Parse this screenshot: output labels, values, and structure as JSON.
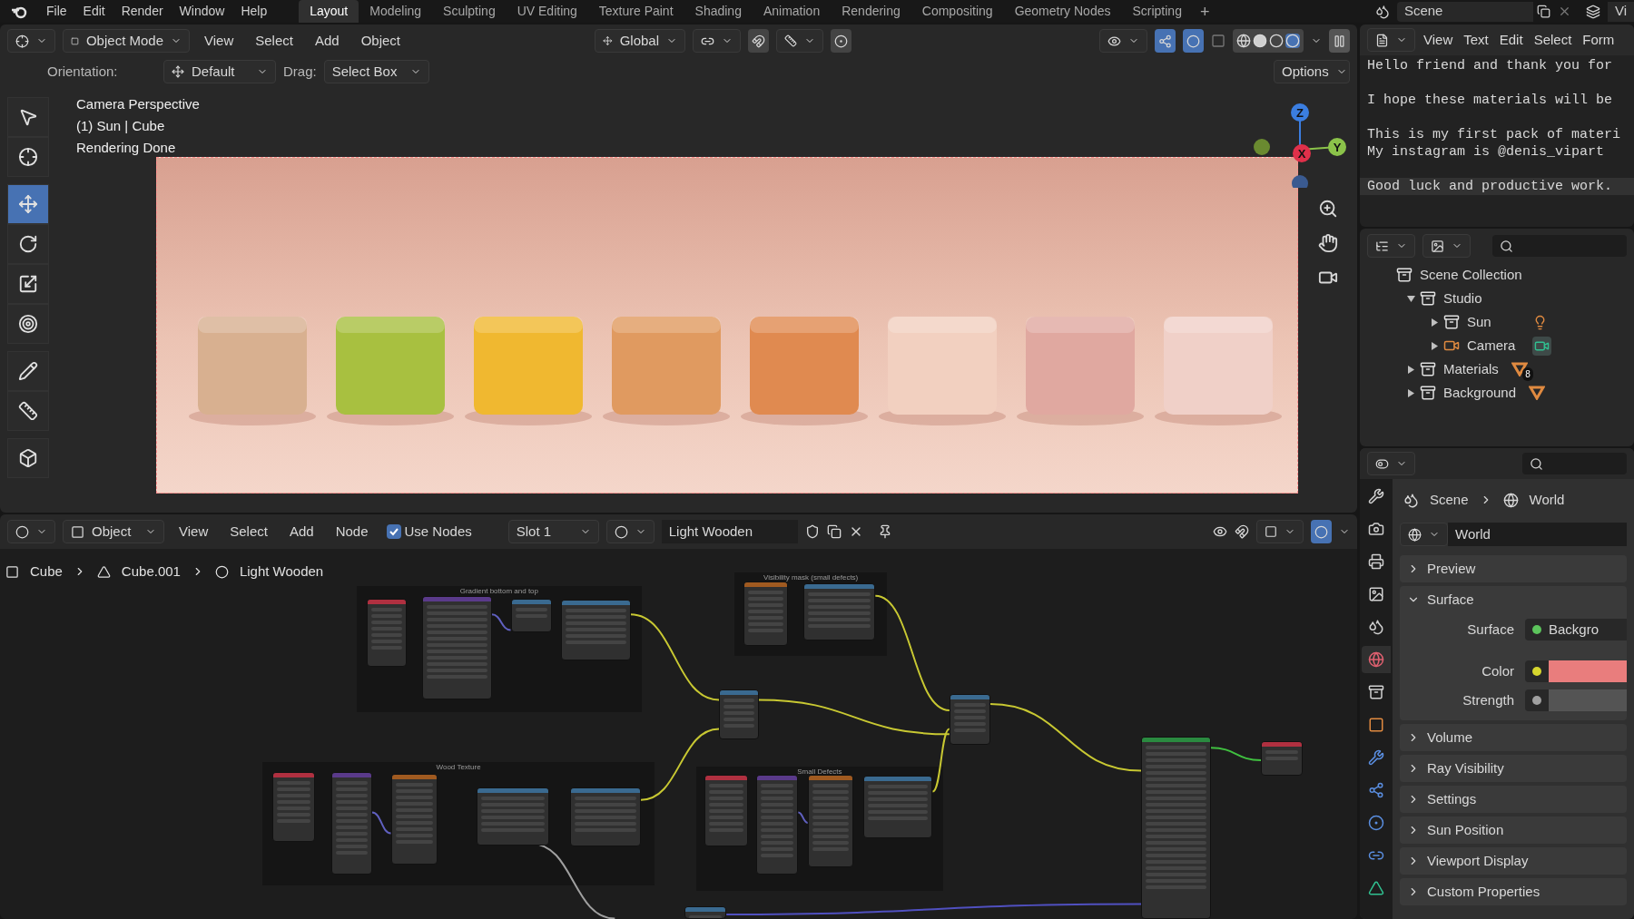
{
  "menu": [
    "File",
    "Edit",
    "Render",
    "Window",
    "Help"
  ],
  "workspaces": [
    {
      "label": "Layout",
      "selected": true
    },
    {
      "label": "Modeling",
      "selected": false
    },
    {
      "label": "Sculpting",
      "selected": false
    },
    {
      "label": "UV Editing",
      "selected": false
    },
    {
      "label": "Texture Paint",
      "selected": false
    },
    {
      "label": "Shading",
      "selected": false
    },
    {
      "label": "Animation",
      "selected": false
    },
    {
      "label": "Rendering",
      "selected": false
    },
    {
      "label": "Compositing",
      "selected": false
    },
    {
      "label": "Geometry Nodes",
      "selected": false
    },
    {
      "label": "Scripting",
      "selected": false
    }
  ],
  "add_workspace": "+",
  "scene": "Scene",
  "view_layer": "Vi",
  "viewport_header": {
    "mode": "Object Mode",
    "menus": [
      "View",
      "Select",
      "Add",
      "Object"
    ],
    "orientation": "Global"
  },
  "tool_settings": {
    "orientation_label": "Orientation:",
    "orientation": "Default",
    "drag_label": "Drag:",
    "drag": "Select Box",
    "options": "Options"
  },
  "viewport_info": [
    "Camera Perspective",
    "(1) Sun | Cube",
    "Rendering Done"
  ],
  "tools": [
    {
      "kind": "select",
      "selected": false
    },
    {
      "kind": "cursor",
      "selected": false
    },
    {
      "kind": "move",
      "selected": true
    },
    {
      "kind": "rotate",
      "selected": false
    },
    {
      "kind": "scale",
      "selected": false
    },
    {
      "kind": "transform",
      "selected": false
    },
    {
      "kind": "annotate",
      "selected": false
    },
    {
      "kind": "measure",
      "selected": false
    },
    {
      "kind": "add_cube",
      "selected": false
    }
  ],
  "gizmo": {
    "z": "Z",
    "x": "X",
    "y": "Y"
  },
  "text_editor": {
    "menus": [
      "View",
      "Text",
      "Edit",
      "Select",
      "Form"
    ],
    "paragraphs": [
      {
        "lines": [
          {
            "text": "Hello friend and thank you for",
            "current": false
          }
        ]
      },
      {
        "lines": [
          {
            "text": "I hope these materials will be",
            "current": false
          }
        ]
      },
      {
        "lines": [
          {
            "text": "This is my first pack of materi",
            "current": false
          },
          {
            "text": "My instagram is @denis_vipart",
            "current": false
          }
        ]
      },
      {
        "lines": [
          {
            "text": "Good luck and productive work.",
            "current": true
          }
        ]
      }
    ]
  },
  "outliner": {
    "tree": [
      {
        "label": "Scene Collection",
        "kind": "collection",
        "children": [
          {
            "label": "Studio",
            "kind": "collection",
            "expanded": true,
            "children": [
              {
                "label": "Sun",
                "kind": "collection",
                "expanded": false,
                "data": {
                  "kind": "light"
                }
              },
              {
                "label": "Camera",
                "kind": "camera",
                "expanded": false,
                "data": {
                  "kind": "camera"
                }
              }
            ]
          },
          {
            "label": "Materials",
            "kind": "collection",
            "expanded": false,
            "data": {
              "kind": "material",
              "badge": "8"
            }
          },
          {
            "label": "Background",
            "kind": "collection",
            "expanded": false,
            "data": {
              "kind": "material"
            }
          }
        ]
      }
    ]
  },
  "properties": {
    "tabs": [
      {
        "kind": "tool",
        "selected": false
      },
      {
        "kind": "render",
        "selected": false
      },
      {
        "kind": "output",
        "selected": false
      },
      {
        "kind": "view_layer",
        "selected": false
      },
      {
        "kind": "scene",
        "selected": false
      },
      {
        "kind": "world",
        "selected": true
      },
      {
        "kind": "collection",
        "selected": false
      },
      {
        "kind": "object",
        "selected": false
      },
      {
        "kind": "modifier",
        "selected": false
      },
      {
        "kind": "particles",
        "selected": false
      },
      {
        "kind": "physics",
        "selected": false
      },
      {
        "kind": "constraints",
        "selected": false
      },
      {
        "kind": "data",
        "selected": false
      }
    ],
    "breadcrumb": [
      "Scene",
      "World"
    ],
    "world": "World",
    "panels": [
      {
        "label": "Preview",
        "expanded": false
      },
      {
        "label": "Surface",
        "expanded": true,
        "fields": [
          {
            "label": "Surface",
            "kind": "shader",
            "value": "Backgro",
            "socket": {
              "color": "#5cc45c"
            }
          },
          {
            "label": "Color",
            "kind": "swatch",
            "swatch": {
              "color": "#e97d7d"
            },
            "socket": {
              "color": "#d6d62e"
            }
          },
          {
            "label": "Strength",
            "kind": "number",
            "socket": {
              "color": "#a0a0a0"
            }
          }
        ]
      },
      {
        "label": "Volume",
        "expanded": false
      },
      {
        "label": "Ray Visibility",
        "expanded": false
      },
      {
        "label": "Settings",
        "expanded": false
      },
      {
        "label": "Sun Position",
        "expanded": false
      },
      {
        "label": "Viewport Display",
        "expanded": false
      },
      {
        "label": "Custom Properties",
        "expanded": false
      }
    ]
  },
  "node_editor": {
    "object_mode": "Object",
    "menus": [
      "View",
      "Select",
      "Add",
      "Node"
    ],
    "use_nodes": {
      "label": "Use Nodes",
      "checked": true
    },
    "slot": "Slot 1",
    "material": "Light Wooden",
    "breadcrumb": [
      "Cube",
      "Cube.001",
      "Light Wooden"
    ],
    "frames": [
      "Gradient bottom and top",
      "Visibility mask (small defects)",
      "Wood Texture",
      "Small Defects"
    ]
  }
}
